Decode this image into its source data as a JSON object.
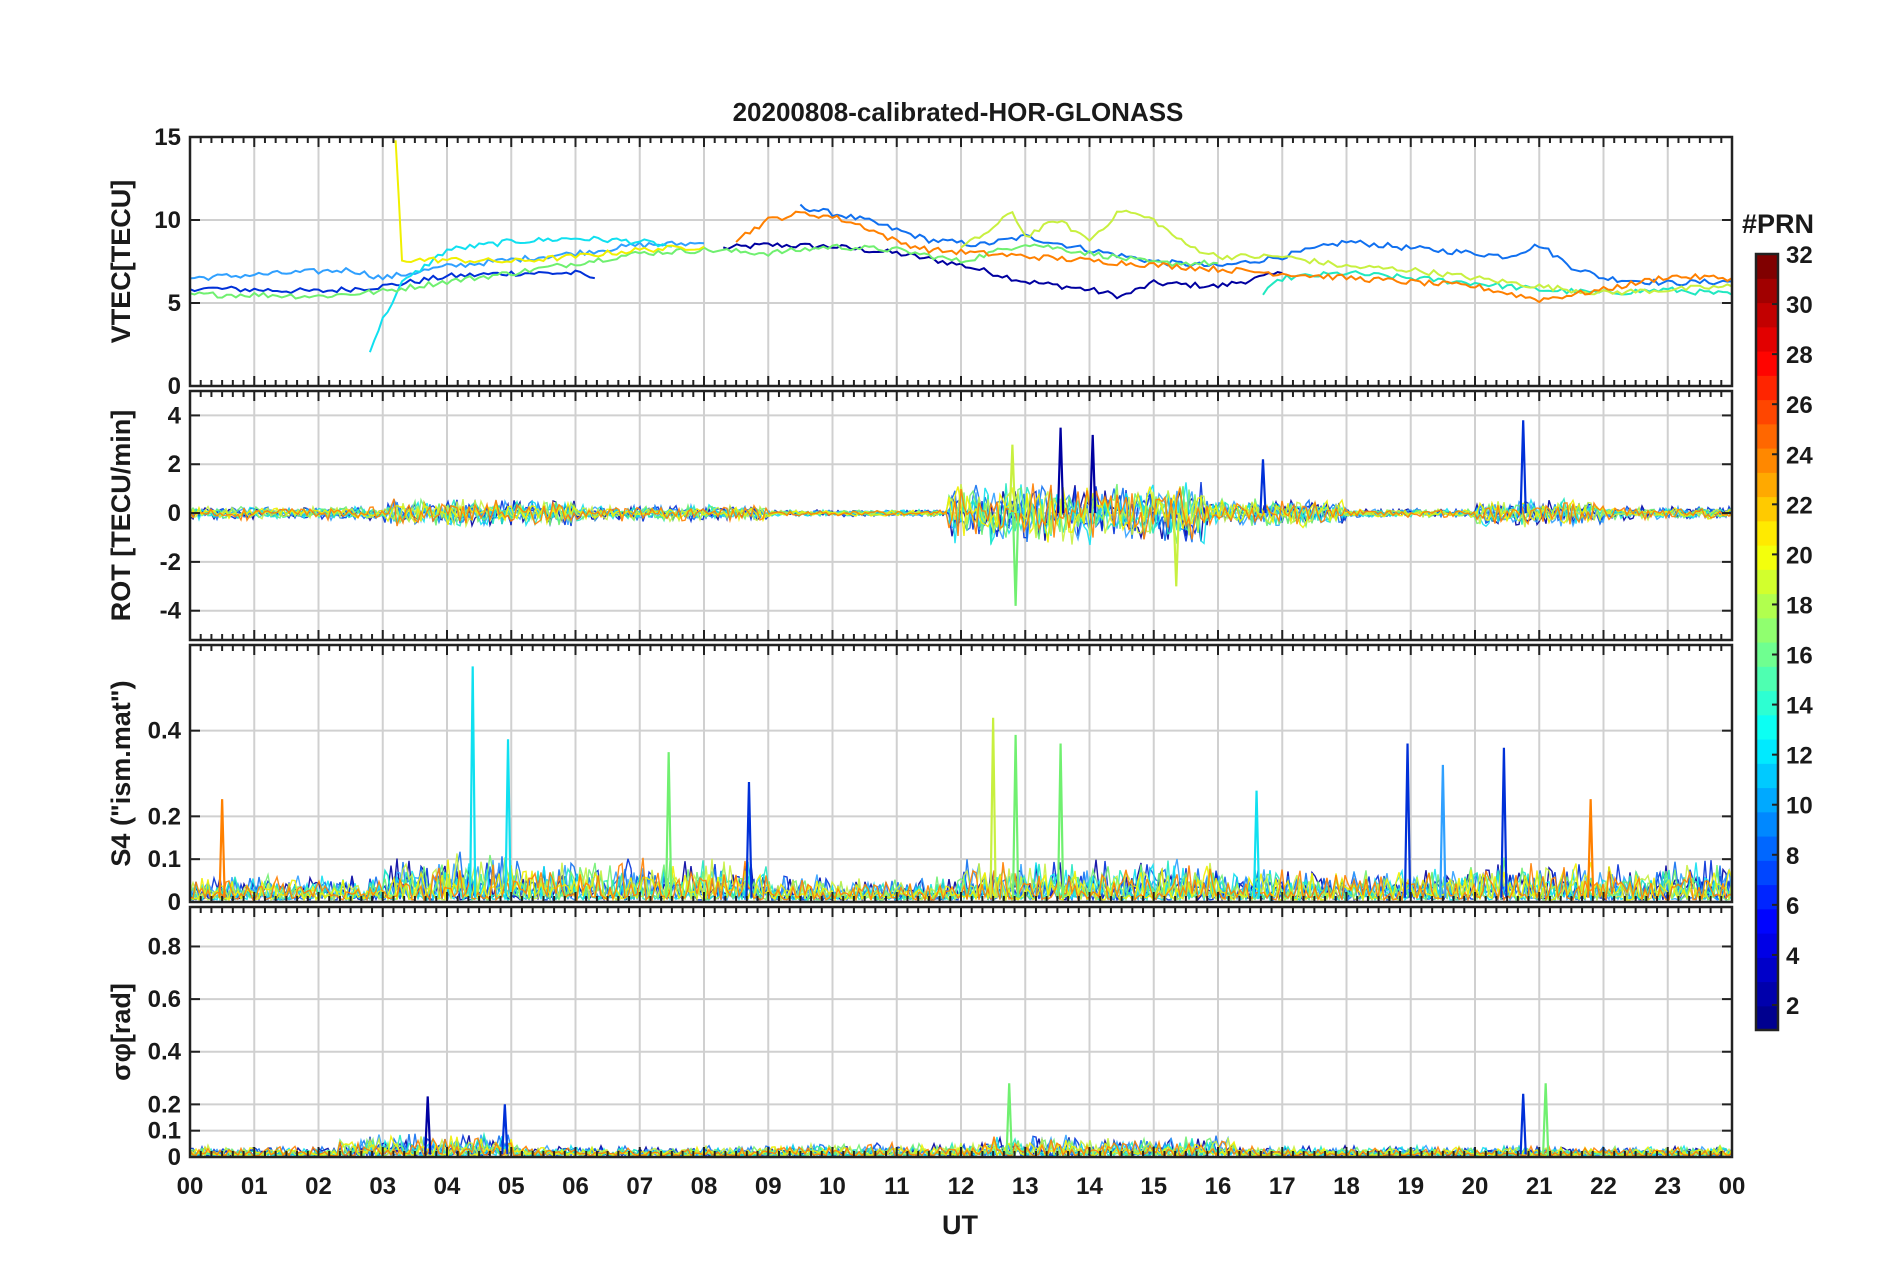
{
  "figure": {
    "title": "20200808-calibrated-HOR-GLONASS",
    "xlabel": "UT",
    "colorbar_label": "#PRN"
  },
  "chart_data": {
    "type": "line",
    "title": "20200808-calibrated-HOR-GLONASS",
    "xlabel": "UT",
    "x_ticks": [
      "00",
      "01",
      "02",
      "03",
      "04",
      "05",
      "06",
      "07",
      "08",
      "09",
      "10",
      "11",
      "12",
      "13",
      "14",
      "15",
      "16",
      "17",
      "18",
      "19",
      "20",
      "21",
      "22",
      "23",
      "00"
    ],
    "xlim_hours": [
      0,
      24
    ],
    "grid": true,
    "colorbar": {
      "label": "#PRN",
      "range": [
        1,
        32
      ],
      "ticks": [
        2,
        4,
        6,
        8,
        10,
        12,
        14,
        16,
        18,
        20,
        22,
        24,
        26,
        28,
        30,
        32
      ],
      "colormap": "jet"
    },
    "panels": [
      {
        "key": "vtec",
        "ylabel": "VTEC[TECU]",
        "ylim": [
          0,
          15
        ],
        "yticks": [
          0,
          5,
          10,
          15
        ],
        "series": [
          {
            "prn": 1,
            "color": "#0000a0",
            "points": [
              [
                8.3,
                8.3
              ],
              [
                9,
                8.5
              ],
              [
                10,
                8.4
              ],
              [
                11,
                8.0
              ],
              [
                12,
                7.3
              ],
              [
                13,
                6.3
              ],
              [
                14,
                5.8
              ],
              [
                14.5,
                5.4
              ],
              [
                15,
                6.2
              ],
              [
                16,
                6.0
              ],
              [
                17,
                6.8
              ]
            ]
          },
          {
            "prn": 3,
            "color": "#0030d8",
            "points": [
              [
                0,
                5.9
              ],
              [
                1,
                5.8
              ],
              [
                2,
                5.7
              ],
              [
                3,
                6.0
              ],
              [
                4,
                6.6
              ],
              [
                5,
                6.8
              ],
              [
                6,
                6.8
              ],
              [
                6.3,
                6.5
              ]
            ]
          },
          {
            "prn": 6,
            "color": "#1070f0",
            "points": [
              [
                9.5,
                10.8
              ],
              [
                10.5,
                10.0
              ],
              [
                11.5,
                8.8
              ],
              [
                12.3,
                8.5
              ],
              [
                13,
                9.0
              ],
              [
                14,
                8.2
              ],
              [
                15,
                7.5
              ],
              [
                16,
                7.2
              ],
              [
                17,
                7.8
              ],
              [
                18,
                8.7
              ],
              [
                19,
                8.3
              ],
              [
                20,
                8.0
              ],
              [
                20.5,
                7.8
              ],
              [
                21,
                8.5
              ],
              [
                21.5,
                7.2
              ],
              [
                22,
                6.5
              ],
              [
                23,
                6.2
              ],
              [
                24,
                6.3
              ]
            ]
          },
          {
            "prn": 9,
            "color": "#30a0ff",
            "points": [
              [
                0,
                6.5
              ],
              [
                1,
                6.7
              ],
              [
                2,
                6.9
              ],
              [
                2.5,
                7.0
              ],
              [
                3,
                6.5
              ],
              [
                4,
                7.2
              ],
              [
                5,
                7.6
              ],
              [
                6,
                8.0
              ],
              [
                7,
                8.5
              ],
              [
                8,
                8.6
              ]
            ]
          },
          {
            "prn": 12,
            "color": "#10e0f0",
            "points": [
              [
                2.8,
                2.2
              ],
              [
                3.0,
                4.0
              ],
              [
                3.3,
                6.2
              ],
              [
                4,
                8.2
              ],
              [
                5,
                8.7
              ],
              [
                6,
                8.9
              ],
              [
                7,
                8.7
              ],
              [
                7.5,
                8.4
              ]
            ]
          },
          {
            "prn": 14,
            "color": "#20e8c0",
            "points": [
              [
                16.7,
                5.5
              ],
              [
                17,
                6.5
              ],
              [
                18,
                6.8
              ],
              [
                19,
                6.5
              ],
              [
                20,
                6.2
              ],
              [
                21,
                5.8
              ],
              [
                22,
                5.6
              ],
              [
                23,
                5.8
              ],
              [
                24,
                5.5
              ]
            ]
          },
          {
            "prn": 16,
            "color": "#70f070",
            "points": [
              [
                0,
                5.5
              ],
              [
                1,
                5.5
              ],
              [
                2,
                5.4
              ],
              [
                3,
                5.7
              ],
              [
                4,
                6.3
              ],
              [
                5,
                6.8
              ],
              [
                6,
                7.4
              ],
              [
                7,
                8.0
              ],
              [
                8,
                8.2
              ],
              [
                9,
                8.0
              ],
              [
                10,
                8.4
              ],
              [
                11,
                8.2
              ],
              [
                12,
                7.5
              ],
              [
                13,
                8.6
              ],
              [
                14,
                8.0
              ],
              [
                15,
                7.4
              ],
              [
                16,
                7.4
              ]
            ]
          },
          {
            "prn": 18,
            "color": "#c8f040",
            "points": [
              [
                12,
                8.3
              ],
              [
                12.5,
                9.5
              ],
              [
                12.8,
                10.5
              ],
              [
                13,
                9.0
              ],
              [
                13.5,
                10.0
              ],
              [
                14,
                8.8
              ],
              [
                14.5,
                10.6
              ],
              [
                15,
                10.0
              ],
              [
                15.5,
                8.5
              ],
              [
                16,
                7.8
              ],
              [
                17,
                7.8
              ],
              [
                18,
                7.2
              ],
              [
                19,
                7.0
              ],
              [
                20,
                6.5
              ],
              [
                21,
                6.0
              ],
              [
                22,
                5.6
              ],
              [
                23,
                5.8
              ],
              [
                24,
                6.0
              ]
            ]
          },
          {
            "prn": 20,
            "color": "#f0f000",
            "points": [
              [
                3.2,
                14.8
              ],
              [
                3.3,
                7.6
              ],
              [
                4,
                7.6
              ],
              [
                5,
                7.5
              ],
              [
                6,
                7.8
              ],
              [
                7,
                8.2
              ],
              [
                8,
                8.4
              ]
            ]
          },
          {
            "prn": 23,
            "color": "#ff8000",
            "points": [
              [
                8.5,
                8.8
              ],
              [
                9,
                10.0
              ],
              [
                9.5,
                10.4
              ],
              [
                10,
                10.2
              ],
              [
                10.5,
                9.6
              ],
              [
                11,
                8.7
              ],
              [
                11.5,
                8.2
              ],
              [
                20,
                6.0
              ],
              [
                21,
                5.2
              ],
              [
                22,
                5.8
              ],
              [
                23,
                6.6
              ],
              [
                24,
                6.5
              ]
            ]
          }
        ]
      },
      {
        "key": "rot",
        "ylabel": "ROT [TECU/min]",
        "ylim": [
          -5.2,
          5
        ],
        "yticks": [
          -4,
          -2,
          0,
          2,
          4
        ],
        "noise_bands": [
          {
            "x0": 0,
            "x1": 3.0,
            "amp": 0.3
          },
          {
            "x0": 3.0,
            "x1": 6.0,
            "amp": 0.6
          },
          {
            "x0": 6.0,
            "x1": 9.0,
            "amp": 0.35
          },
          {
            "x0": 9.0,
            "x1": 11.8,
            "amp": 0.15
          },
          {
            "x0": 11.8,
            "x1": 15.8,
            "amp": 1.4
          },
          {
            "x0": 15.8,
            "x1": 18.0,
            "amp": 0.6
          },
          {
            "x0": 18.0,
            "x1": 20.0,
            "amp": 0.2
          },
          {
            "x0": 20.0,
            "x1": 22.0,
            "amp": 0.6
          },
          {
            "x0": 22.0,
            "x1": 24.0,
            "amp": 0.3
          }
        ],
        "spikes": [
          {
            "x": 12.85,
            "y": -3.8,
            "color": "#70f070"
          },
          {
            "x": 13.55,
            "y": 3.5,
            "color": "#0000a0"
          },
          {
            "x": 14.05,
            "y": 3.2,
            "color": "#0000a0"
          },
          {
            "x": 15.35,
            "y": -3.0,
            "color": "#c8f040"
          },
          {
            "x": 12.8,
            "y": 2.8,
            "color": "#c8f040"
          },
          {
            "x": 20.75,
            "y": 3.8,
            "color": "#0030d8"
          },
          {
            "x": 16.7,
            "y": 2.2,
            "color": "#0030d8"
          }
        ]
      },
      {
        "key": "s4",
        "ylabel": "S4 (\"ism.mat\")",
        "ylim": [
          0,
          0.6
        ],
        "yticks": [
          0,
          0.1,
          0.2,
          0.4
        ],
        "noise_bands": [
          {
            "x0": 0,
            "x1": 3.0,
            "amp": 0.06
          },
          {
            "x0": 3.0,
            "x1": 5.0,
            "amp": 0.12
          },
          {
            "x0": 5.0,
            "x1": 9.0,
            "amp": 0.1
          },
          {
            "x0": 9.0,
            "x1": 12.0,
            "amp": 0.06
          },
          {
            "x0": 12.0,
            "x1": 16.0,
            "amp": 0.1
          },
          {
            "x0": 16.0,
            "x1": 20.0,
            "amp": 0.08
          },
          {
            "x0": 20.0,
            "x1": 24.0,
            "amp": 0.1
          }
        ],
        "spikes": [
          {
            "x": 4.4,
            "y": 0.55,
            "color": "#10e0f0"
          },
          {
            "x": 4.95,
            "y": 0.38,
            "color": "#10e0f0"
          },
          {
            "x": 7.45,
            "y": 0.35,
            "color": "#70f070"
          },
          {
            "x": 12.5,
            "y": 0.43,
            "color": "#c8f040"
          },
          {
            "x": 12.85,
            "y": 0.39,
            "color": "#70f070"
          },
          {
            "x": 13.55,
            "y": 0.37,
            "color": "#70f070"
          },
          {
            "x": 18.95,
            "y": 0.37,
            "color": "#0030d8"
          },
          {
            "x": 20.45,
            "y": 0.36,
            "color": "#0030d8"
          },
          {
            "x": 19.5,
            "y": 0.32,
            "color": "#30a0ff"
          },
          {
            "x": 0.5,
            "y": 0.24,
            "color": "#ff8000"
          },
          {
            "x": 8.7,
            "y": 0.28,
            "color": "#0030d8"
          },
          {
            "x": 16.6,
            "y": 0.26,
            "color": "#10e0f0"
          },
          {
            "x": 21.8,
            "y": 0.24,
            "color": "#ff8000"
          }
        ]
      },
      {
        "key": "sigma",
        "ylabel": "σφ[rad]",
        "ylim": [
          0,
          0.95
        ],
        "yticks": [
          0,
          0.1,
          0.2,
          0.4,
          0.6,
          0.8
        ],
        "noise_bands": [
          {
            "x0": 0,
            "x1": 2.3,
            "amp": 0.04
          },
          {
            "x0": 2.3,
            "x1": 5.0,
            "amp": 0.09
          },
          {
            "x0": 5.0,
            "x1": 9.0,
            "amp": 0.04
          },
          {
            "x0": 9.0,
            "x1": 12.3,
            "amp": 0.05
          },
          {
            "x0": 12.3,
            "x1": 16.3,
            "amp": 0.08
          },
          {
            "x0": 16.3,
            "x1": 24.0,
            "amp": 0.04
          }
        ],
        "spikes": [
          {
            "x": 12.75,
            "y": 0.28,
            "color": "#70f070"
          },
          {
            "x": 21.1,
            "y": 0.28,
            "color": "#70f070"
          },
          {
            "x": 20.75,
            "y": 0.24,
            "color": "#0030d8"
          },
          {
            "x": 3.7,
            "y": 0.23,
            "color": "#0000a0"
          },
          {
            "x": 4.9,
            "y": 0.2,
            "color": "#0030d8"
          }
        ]
      }
    ]
  }
}
